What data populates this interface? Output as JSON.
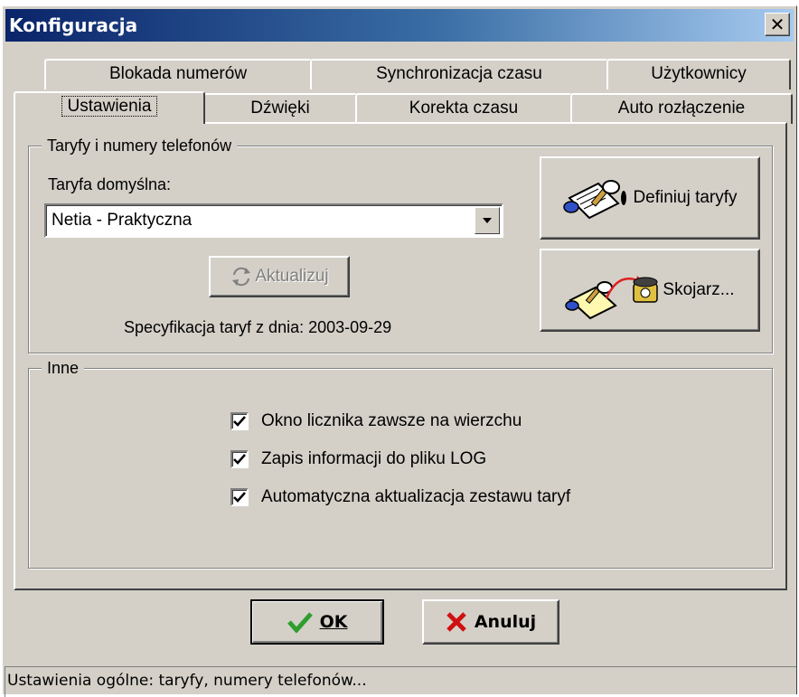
{
  "window": {
    "title": "Konfiguracja",
    "close_glyph": "✕"
  },
  "tabs": {
    "row1": [
      {
        "label": "Blokada numerów"
      },
      {
        "label": "Synchronizacja czasu"
      },
      {
        "label": "Użytkownicy"
      }
    ],
    "row2": [
      {
        "label": "Ustawienia",
        "active": true
      },
      {
        "label": "Dźwięki"
      },
      {
        "label": "Korekta czasu"
      },
      {
        "label": "Auto rozłączenie"
      }
    ]
  },
  "tariffs": {
    "group_title": "Taryfy i numery telefonów",
    "default_label": "Taryfa domyślna:",
    "default_value": "Netia - Praktyczna",
    "update_button": "Aktualizuj",
    "spec_text": "Specyfikacja taryf z dnia: 2003-09-29",
    "define_button": "Definiuj taryfy",
    "link_button": "Skojarz..."
  },
  "other": {
    "group_title": "Inne",
    "options": [
      {
        "label": "Okno licznika zawsze na wierzchu",
        "checked": true
      },
      {
        "label": "Zapis informacji do pliku LOG",
        "checked": true
      },
      {
        "label": "Automatyczna aktualizacja zestawu taryf",
        "checked": true
      }
    ]
  },
  "buttons": {
    "ok": "OK",
    "cancel": "Anuluj"
  },
  "status": {
    "text": "Ustawienia ogólne: taryfy, numery telefonów..."
  },
  "colors": {
    "face": "#d4d0c8",
    "title_start": "#0a246a",
    "title_end": "#a6caf0",
    "ok_check": "#2e9e2e",
    "cancel_x": "#d01010"
  },
  "icons": {
    "define": "notepad-pen-icon",
    "link": "notepad-phone-icon",
    "update": "refresh-icon",
    "ok": "checkmark-icon",
    "cancel": "x-mark-icon"
  }
}
